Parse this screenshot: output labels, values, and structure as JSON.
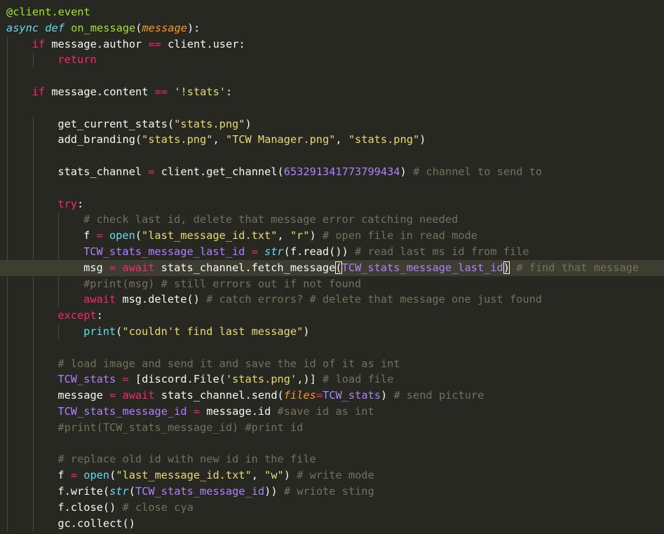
{
  "editor": {
    "current_line": 16,
    "lines": [
      {
        "indent": 0,
        "tokens": [
          {
            "t": "@client.event",
            "k": "deco"
          }
        ]
      },
      {
        "indent": 0,
        "tokens": [
          {
            "t": "async",
            "k": "storage"
          },
          {
            "t": " ",
            "k": "plain"
          },
          {
            "t": "def",
            "k": "storage"
          },
          {
            "t": " ",
            "k": "plain"
          },
          {
            "t": "on_message",
            "k": "func"
          },
          {
            "t": "(",
            "k": "plain"
          },
          {
            "t": "message",
            "k": "param"
          },
          {
            "t": "):",
            "k": "plain"
          }
        ]
      },
      {
        "indent": 1,
        "tokens": [
          {
            "t": "if",
            "k": "kw"
          },
          {
            "t": " message.author ",
            "k": "plain"
          },
          {
            "t": "==",
            "k": "op"
          },
          {
            "t": " client.user:",
            "k": "plain"
          }
        ]
      },
      {
        "indent": 2,
        "tokens": [
          {
            "t": "return",
            "k": "kw"
          }
        ]
      },
      {
        "indent": 0,
        "tokens": []
      },
      {
        "indent": 1,
        "tokens": [
          {
            "t": "if",
            "k": "kw"
          },
          {
            "t": " message.content ",
            "k": "plain"
          },
          {
            "t": "==",
            "k": "op"
          },
          {
            "t": " ",
            "k": "plain"
          },
          {
            "t": "'!stats'",
            "k": "string"
          },
          {
            "t": ":",
            "k": "plain"
          }
        ]
      },
      {
        "indent": 0,
        "tokens": []
      },
      {
        "indent": 2,
        "tokens": [
          {
            "t": "get_current_stats(",
            "k": "plain"
          },
          {
            "t": "\"stats.png\"",
            "k": "string"
          },
          {
            "t": ")",
            "k": "plain"
          }
        ]
      },
      {
        "indent": 2,
        "tokens": [
          {
            "t": "add_branding(",
            "k": "plain"
          },
          {
            "t": "\"stats.png\"",
            "k": "string"
          },
          {
            "t": ", ",
            "k": "plain"
          },
          {
            "t": "\"TCW Manager.png\"",
            "k": "string"
          },
          {
            "t": ", ",
            "k": "plain"
          },
          {
            "t": "\"stats.png\"",
            "k": "string"
          },
          {
            "t": ")",
            "k": "plain"
          }
        ]
      },
      {
        "indent": 0,
        "tokens": []
      },
      {
        "indent": 2,
        "tokens": [
          {
            "t": "stats_channel ",
            "k": "plain"
          },
          {
            "t": "=",
            "k": "op"
          },
          {
            "t": " client.get_channel(",
            "k": "plain"
          },
          {
            "t": "653291341773799434",
            "k": "number"
          },
          {
            "t": ") ",
            "k": "plain"
          },
          {
            "t": "# channel to send to",
            "k": "comment"
          }
        ]
      },
      {
        "indent": 0,
        "tokens": []
      },
      {
        "indent": 2,
        "tokens": [
          {
            "t": "try",
            "k": "kw"
          },
          {
            "t": ":",
            "k": "plain"
          }
        ]
      },
      {
        "indent": 3,
        "tokens": [
          {
            "t": "# check last id, delete that message error catching needed",
            "k": "comment"
          }
        ]
      },
      {
        "indent": 3,
        "tokens": [
          {
            "t": "f ",
            "k": "plain"
          },
          {
            "t": "=",
            "k": "op"
          },
          {
            "t": " ",
            "k": "plain"
          },
          {
            "t": "open",
            "k": "builtin"
          },
          {
            "t": "(",
            "k": "plain"
          },
          {
            "t": "\"last_message_id.txt\"",
            "k": "string"
          },
          {
            "t": ", ",
            "k": "plain"
          },
          {
            "t": "\"r\"",
            "k": "string"
          },
          {
            "t": ") ",
            "k": "plain"
          },
          {
            "t": "# open file in read mode",
            "k": "comment"
          }
        ]
      },
      {
        "indent": 3,
        "tokens": [
          {
            "t": "TCW_stats_message_last_id",
            "k": "var"
          },
          {
            "t": " ",
            "k": "plain"
          },
          {
            "t": "=",
            "k": "op"
          },
          {
            "t": " ",
            "k": "plain"
          },
          {
            "t": "str",
            "k": "storage"
          },
          {
            "t": "(f.read()) ",
            "k": "plain"
          },
          {
            "t": "# read last ms id from file",
            "k": "comment"
          }
        ]
      },
      {
        "indent": 3,
        "tokens": [
          {
            "t": "msg ",
            "k": "plain"
          },
          {
            "t": "=",
            "k": "op"
          },
          {
            "t": " ",
            "k": "plain"
          },
          {
            "t": "await",
            "k": "kw"
          },
          {
            "t": " stats_channel.fetch_message",
            "k": "plain"
          },
          {
            "t": "(",
            "k": "plain",
            "match": true
          },
          {
            "t": "TCW_stats_message_last_id",
            "k": "var"
          },
          {
            "t": ")",
            "k": "plain",
            "match": true
          },
          {
            "t": " ",
            "k": "plain"
          },
          {
            "t": "# find that message",
            "k": "comment"
          }
        ]
      },
      {
        "indent": 3,
        "tokens": [
          {
            "t": "#print(msg) # still errors out if not found",
            "k": "comment"
          }
        ]
      },
      {
        "indent": 3,
        "tokens": [
          {
            "t": "await",
            "k": "kw"
          },
          {
            "t": " msg.delete() ",
            "k": "plain"
          },
          {
            "t": "# catch errors? # delete that message one just found",
            "k": "comment"
          }
        ]
      },
      {
        "indent": 2,
        "tokens": [
          {
            "t": "except",
            "k": "kw"
          },
          {
            "t": ":",
            "k": "plain"
          }
        ]
      },
      {
        "indent": 3,
        "tokens": [
          {
            "t": "print",
            "k": "builtin"
          },
          {
            "t": "(",
            "k": "plain"
          },
          {
            "t": "\"couldn't find last message\"",
            "k": "string"
          },
          {
            "t": ")",
            "k": "plain"
          }
        ]
      },
      {
        "indent": 0,
        "tokens": []
      },
      {
        "indent": 2,
        "tokens": [
          {
            "t": "# load image and send it and save the id of it as int",
            "k": "comment"
          }
        ]
      },
      {
        "indent": 2,
        "tokens": [
          {
            "t": "TCW_stats",
            "k": "var"
          },
          {
            "t": " ",
            "k": "plain"
          },
          {
            "t": "=",
            "k": "op"
          },
          {
            "t": " [discord.File(",
            "k": "plain"
          },
          {
            "t": "'stats.png'",
            "k": "string"
          },
          {
            "t": ",)] ",
            "k": "plain"
          },
          {
            "t": "# load file",
            "k": "comment"
          }
        ]
      },
      {
        "indent": 2,
        "tokens": [
          {
            "t": "message ",
            "k": "plain"
          },
          {
            "t": "=",
            "k": "op"
          },
          {
            "t": " ",
            "k": "plain"
          },
          {
            "t": "await",
            "k": "kw"
          },
          {
            "t": " stats_channel.send(",
            "k": "plain"
          },
          {
            "t": "files",
            "k": "pm"
          },
          {
            "t": "=",
            "k": "op"
          },
          {
            "t": "TCW_stats",
            "k": "var"
          },
          {
            "t": ") ",
            "k": "plain"
          },
          {
            "t": "# send picture",
            "k": "comment"
          }
        ]
      },
      {
        "indent": 2,
        "tokens": [
          {
            "t": "TCW_stats_message_id",
            "k": "var"
          },
          {
            "t": " ",
            "k": "plain"
          },
          {
            "t": "=",
            "k": "op"
          },
          {
            "t": " message.id ",
            "k": "plain"
          },
          {
            "t": "#save id as int",
            "k": "comment"
          }
        ]
      },
      {
        "indent": 2,
        "tokens": [
          {
            "t": "#print(TCW_stats_message_id) #print id",
            "k": "comment"
          }
        ]
      },
      {
        "indent": 0,
        "tokens": []
      },
      {
        "indent": 2,
        "tokens": [
          {
            "t": "# replace old id with new id in the file",
            "k": "comment"
          }
        ]
      },
      {
        "indent": 2,
        "tokens": [
          {
            "t": "f ",
            "k": "plain"
          },
          {
            "t": "=",
            "k": "op"
          },
          {
            "t": " ",
            "k": "plain"
          },
          {
            "t": "open",
            "k": "builtin"
          },
          {
            "t": "(",
            "k": "plain"
          },
          {
            "t": "\"last_message_id.txt\"",
            "k": "string"
          },
          {
            "t": ", ",
            "k": "plain"
          },
          {
            "t": "\"w\"",
            "k": "string"
          },
          {
            "t": ") ",
            "k": "plain"
          },
          {
            "t": "# write mode",
            "k": "comment"
          }
        ]
      },
      {
        "indent": 2,
        "tokens": [
          {
            "t": "f.write(",
            "k": "plain"
          },
          {
            "t": "str",
            "k": "storage"
          },
          {
            "t": "(",
            "k": "plain"
          },
          {
            "t": "TCW_stats_message_id",
            "k": "var"
          },
          {
            "t": ")) ",
            "k": "plain"
          },
          {
            "t": "# wriote sting",
            "k": "comment"
          }
        ]
      },
      {
        "indent": 2,
        "tokens": [
          {
            "t": "f.close() ",
            "k": "plain"
          },
          {
            "t": "# close cya",
            "k": "comment"
          }
        ]
      },
      {
        "indent": 2,
        "tokens": [
          {
            "t": "gc.collect()",
            "k": "plain"
          }
        ]
      }
    ]
  }
}
